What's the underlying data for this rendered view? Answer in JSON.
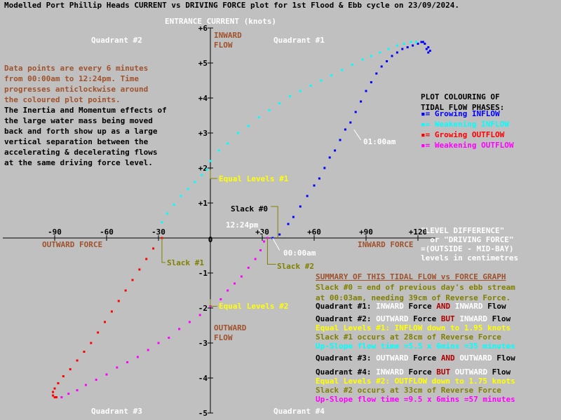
{
  "title": "Modelled Port Phillip Heads CURRENT vs DRIVING FORCE plot for 1st Flood & Ebb cycle on 23/09/2024.",
  "y_axis_title": "ENTRANCE CURRENT (knots)",
  "inward_flow_label": "INWARD FLOW",
  "outward_flow_label": "OUTWARD FLOW",
  "outward_force_label": "OUTWARD FORCE",
  "inward_force_label": "INWARD FORCE",
  "x_axis_title": "\"LEVEL DIFFERENCE\"\n  or \"DRIVING FORCE\"\n=(OUTSIDE - MID-BAY)\nlevels in centimetres",
  "quadrants": {
    "q1": "Quadrant #1",
    "q2": "Quadrant #2",
    "q3": "Quadrant #3",
    "q4": "Quadrant #4"
  },
  "intro_text": "Data points are every 6 minutes\nfrom 00:00am to 12:24pm. Time\nprogresses anticlockwise around\nthe coloured plot points.",
  "inertia_text": "The Inertia and Momentum effects of\nthe large water mass being moved\nback and forth show up as a large\nvertical separation between the\naccelerating & decelerating flows\nat the same driving force level.",
  "legend": {
    "title": "PLOT COLOURING OF\nTIDAL FLOW PHASES:",
    "items": [
      {
        "label": "Growing INFLOW",
        "color": "#0000ff"
      },
      {
        "label": "Weakening INFLOW",
        "color": "#00ffff"
      },
      {
        "label": "Growing OUTFLOW",
        "color": "#ff0000"
      },
      {
        "label": "Weakening OUTFLOW",
        "color": "#ff00ff"
      }
    ]
  },
  "annotations": {
    "t0100": "01:00am",
    "slack0": "Slack #0",
    "t1224": "12:24pm",
    "t0000": "00:00am",
    "slack1": "Slack #1",
    "slack2": "Slack #2",
    "eq1": "Equal Levels #1",
    "eq2": "Equal Levels #2"
  },
  "summary": {
    "heading": "SUMMARY OF THIS TIDAL FLOW vs FORCE GRAPH",
    "slack0": "Slack #0 = end of previous day's ebb stream\nat 00:03am, needing 39cm of Reverse Force.",
    "q1_pre": "Quadrant #1: ",
    "q1_a": "INWARD",
    "q1_b": " Force ",
    "q1_c": "AND",
    "q1_d": " ",
    "q1_e": "INWARD",
    "q1_f": " Flow",
    "q2_pre": "Quadrant #2: ",
    "q2_a": "OUTWARD",
    "q2_b": " Force ",
    "q2_c": "BUT",
    "q2_d": " ",
    "q2_e": "INWARD",
    "q2_f": " Flow",
    "eq1_line": "Equal Levels #1: INFLOW down to 1.95 knots",
    "slack1_line": "Slack #1 occurs at 28cm of Reverse Force",
    "upslope1": "Up-Slope flow time =5.5 x 6mins =35 minutes",
    "q3_pre": "Quadrant #3: ",
    "q3_a": "OUTWARD",
    "q3_b": " Force ",
    "q3_c": "AND",
    "q3_d": " ",
    "q3_e": "OUTWARD",
    "q3_f": " Flow",
    "q4_pre": "Quadrant #4: ",
    "q4_a": "INWARD",
    "q4_b": " Force ",
    "q4_c": "BUT",
    "q4_d": " ",
    "q4_e": "OUTWARD",
    "q4_f": " Flow",
    "eq2_line": "Equal Levels #2: OUTFLOW down to 1.75 knots",
    "slack2_line": "Slack #2 occurs at 33cm of Reverse Force",
    "upslope2": "Up-Slope flow time =9.5 x 6mins =57 minutes"
  },
  "chart_data": {
    "type": "scatter",
    "xlabel": "LEVEL DIFFERENCE (cm)",
    "ylabel": "ENTRANCE CURRENT (knots)",
    "xlim": [
      -105,
      130
    ],
    "ylim": [
      -5,
      6
    ],
    "x_ticks": [
      "-90",
      "-60",
      "-30",
      "0",
      "+30",
      "+60",
      "+90",
      "+120"
    ],
    "y_ticks": [
      "+6",
      "+5",
      "+4",
      "+3",
      "+2",
      "+1",
      "0",
      "-1",
      "-2",
      "-3",
      "-4",
      "-5"
    ],
    "series": [
      {
        "name": "Growing INFLOW",
        "color": "#0000ff",
        "points": [
          [
            36,
            0
          ],
          [
            40,
            0.1
          ],
          [
            45,
            0.4
          ],
          [
            48,
            0.6
          ],
          [
            52,
            0.9
          ],
          [
            56,
            1.2
          ],
          [
            60,
            1.5
          ],
          [
            63,
            1.7
          ],
          [
            66,
            2.0
          ],
          [
            69,
            2.3
          ],
          [
            72,
            2.5
          ],
          [
            75,
            2.8
          ],
          [
            78,
            3.1
          ],
          [
            81,
            3.3
          ],
          [
            84,
            3.6
          ],
          [
            87,
            3.9
          ],
          [
            90,
            4.2
          ],
          [
            93,
            4.45
          ],
          [
            96,
            4.7
          ],
          [
            99,
            4.9
          ],
          [
            102,
            5.05
          ],
          [
            105,
            5.2
          ],
          [
            108,
            5.3
          ],
          [
            111,
            5.4
          ],
          [
            114,
            5.45
          ],
          [
            117,
            5.5
          ],
          [
            120,
            5.55
          ],
          [
            123,
            5.6
          ],
          [
            125,
            5.4
          ],
          [
            126,
            5.3
          ],
          [
            127,
            5.35
          ],
          [
            126,
            5.45
          ],
          [
            124,
            5.55
          ],
          [
            122,
            5.6
          ]
        ]
      },
      {
        "name": "Weakening INFLOW",
        "color": "#00ffff",
        "points": [
          [
            119,
            5.6
          ],
          [
            116,
            5.6
          ],
          [
            112,
            5.55
          ],
          [
            108,
            5.5
          ],
          [
            103,
            5.4
          ],
          [
            98,
            5.3
          ],
          [
            93,
            5.2
          ],
          [
            88,
            5.1
          ],
          [
            82,
            4.95
          ],
          [
            76,
            4.8
          ],
          [
            70,
            4.65
          ],
          [
            64,
            4.5
          ],
          [
            58,
            4.35
          ],
          [
            52,
            4.2
          ],
          [
            46,
            4.05
          ],
          [
            40,
            3.85
          ],
          [
            34,
            3.65
          ],
          [
            28,
            3.45
          ],
          [
            22,
            3.2
          ],
          [
            16,
            3.0
          ],
          [
            10,
            2.7
          ],
          [
            5,
            2.5
          ],
          [
            0,
            2.2
          ],
          [
            -2,
            1.95
          ],
          [
            -5,
            1.8
          ],
          [
            -9,
            1.6
          ],
          [
            -13,
            1.4
          ],
          [
            -17,
            1.2
          ],
          [
            -21,
            0.95
          ],
          [
            -25,
            0.7
          ],
          [
            -28,
            0.45
          ]
        ]
      },
      {
        "name": "Growing OUTFLOW",
        "color": "#ff0000",
        "points": [
          [
            -28,
            0
          ],
          [
            -33,
            -0.3
          ],
          [
            -37,
            -0.6
          ],
          [
            -41,
            -0.9
          ],
          [
            -45,
            -1.2
          ],
          [
            -49,
            -1.5
          ],
          [
            -53,
            -1.8
          ],
          [
            -57,
            -2.1
          ],
          [
            -61,
            -2.4
          ],
          [
            -65,
            -2.7
          ],
          [
            -69,
            -3.0
          ],
          [
            -73,
            -3.25
          ],
          [
            -77,
            -3.5
          ],
          [
            -81,
            -3.75
          ],
          [
            -85,
            -3.95
          ],
          [
            -88,
            -4.15
          ],
          [
            -90,
            -4.3
          ],
          [
            -91,
            -4.4
          ],
          [
            -91,
            -4.5
          ],
          [
            -90,
            -4.55
          ],
          [
            -89,
            -4.55
          ]
        ]
      },
      {
        "name": "Weakening OUTFLOW",
        "color": "#ff00ff",
        "points": [
          [
            -86,
            -4.55
          ],
          [
            -82,
            -4.45
          ],
          [
            -77,
            -4.35
          ],
          [
            -72,
            -4.2
          ],
          [
            -66,
            -4.05
          ],
          [
            -60,
            -3.9
          ],
          [
            -54,
            -3.7
          ],
          [
            -48,
            -3.55
          ],
          [
            -42,
            -3.4
          ],
          [
            -36,
            -3.2
          ],
          [
            -30,
            -3.0
          ],
          [
            -24,
            -2.85
          ],
          [
            -18,
            -2.6
          ],
          [
            -12,
            -2.4
          ],
          [
            -6,
            -2.2
          ],
          [
            0,
            -1.95
          ],
          [
            6,
            -1.75
          ],
          [
            10,
            -1.5
          ],
          [
            14,
            -1.3
          ],
          [
            18,
            -1.1
          ],
          [
            22,
            -0.85
          ],
          [
            26,
            -0.6
          ],
          [
            29,
            -0.35
          ],
          [
            31,
            -0.1
          ],
          [
            33,
            0
          ]
        ]
      }
    ]
  }
}
